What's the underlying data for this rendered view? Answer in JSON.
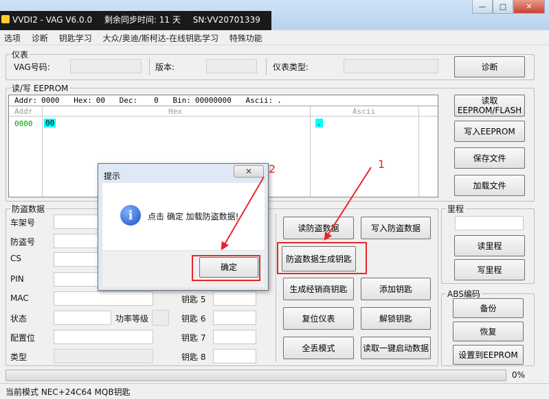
{
  "window": {
    "app_title": "VVDI2 - VAG V6.0.0",
    "sync_time": "剩余同步时间: 11 天",
    "serial": "SN:VV20701339",
    "ctrl_min": "—",
    "ctrl_max": "□",
    "ctrl_close": "✕"
  },
  "menu": [
    "选项",
    "诊断",
    "钥匙学习",
    "大众/奥迪/斯柯达-在线钥匙学习",
    "特殊功能"
  ],
  "instrument": {
    "legend": "仪表",
    "vag_label": "VAG号码:",
    "version_label": "版本:",
    "type_label": "仪表类型:",
    "diag_button": "诊断"
  },
  "eeprom": {
    "legend": "读/写 EEPROM",
    "addr_label": "Addr:",
    "addr_value": "0000",
    "hex_label": "Hex:",
    "hex_value": "00",
    "dec_label": "Dec:",
    "dec_value": "0",
    "bin_label": "Bin:",
    "bin_value": "00000000",
    "ascii_label": "Ascii:",
    "ascii_value": ".",
    "col_addr": "Addr",
    "col_hex": "Hex",
    "col_ascii": "Ascii",
    "row_addr": "0000",
    "row_hex": "00",
    "row_ascii": ".",
    "btn_read_line1": "读取",
    "btn_read_line2": "EEPROM/FLASH",
    "btn_write": "写入EEPROM",
    "btn_save": "保存文件",
    "btn_load": "加载文件"
  },
  "immo": {
    "legend": "防盗数据",
    "labels": [
      "车架号",
      "防盗号",
      "CS",
      "PIN",
      "MAC",
      "状态",
      "配置位",
      "类型"
    ],
    "power_label": "功率等级",
    "keys": [
      "钥匙 5",
      "钥匙 6",
      "钥匙 7",
      "钥匙 8"
    ]
  },
  "actions": {
    "read_immo": "读防盗数据",
    "write_immo": "写入防盗数据",
    "gen_key": "防盗数据生成钥匙",
    "gen_dealer_key": "生成经销商钥匙",
    "add_key": "添加钥匙",
    "reset_cluster": "复位仪表",
    "unlock_key": "解锁钥匙",
    "all_lost": "全丢模式",
    "read_start_data": "读取一键启动数据"
  },
  "mileage": {
    "legend": "里程",
    "read": "读里程",
    "write": "写里程"
  },
  "abs": {
    "legend": "ABS编码",
    "backup": "备份",
    "restore": "恢复",
    "set_eeprom": "设置到EEPROM"
  },
  "progress": {
    "value": 0,
    "label": "0%"
  },
  "status_text": "当前模式 NEC+24C64 MQB钥匙",
  "dialog": {
    "title": "提示",
    "message": "点击 确定 加载防盗数据!",
    "ok": "确定",
    "close": "✕",
    "info_icon": "i"
  },
  "annotations": {
    "label_1": "1",
    "label_2": "2"
  },
  "colors": {
    "highlight": "#e8242a",
    "cyan": "#00ffff",
    "addr_green": "#009900"
  }
}
